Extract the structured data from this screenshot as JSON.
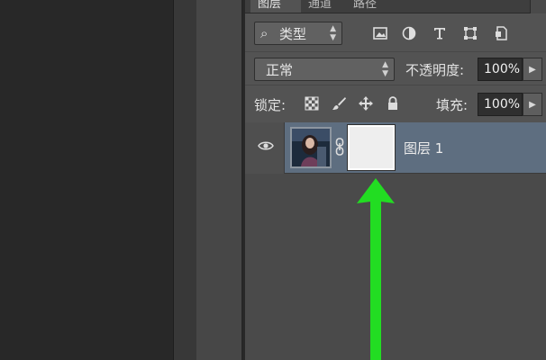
{
  "panel": {
    "tabs": [
      {
        "label": "图层",
        "active": true
      },
      {
        "label": "通道",
        "active": false
      },
      {
        "label": "路径",
        "active": false
      }
    ]
  },
  "filter": {
    "kind_label": "类型",
    "icons": [
      "image-filter-icon",
      "adjustment-filter-icon",
      "type-filter-icon",
      "shape-filter-icon",
      "smart-object-filter-icon"
    ]
  },
  "blend": {
    "mode": "正常",
    "opacity_label": "不透明度:",
    "opacity_value": "100%"
  },
  "lock": {
    "label": "锁定:",
    "icons": [
      "lock-transparency-icon",
      "lock-paint-icon",
      "lock-position-icon",
      "lock-all-icon"
    ],
    "fill_label": "填充:",
    "fill_value": "100%"
  },
  "layers": [
    {
      "name": "图层 1",
      "visible": true,
      "has_mask": true,
      "selected": true
    }
  ],
  "colors": {
    "selected_row": "#5e6e80",
    "annotation_arrow": "#22dd22"
  }
}
